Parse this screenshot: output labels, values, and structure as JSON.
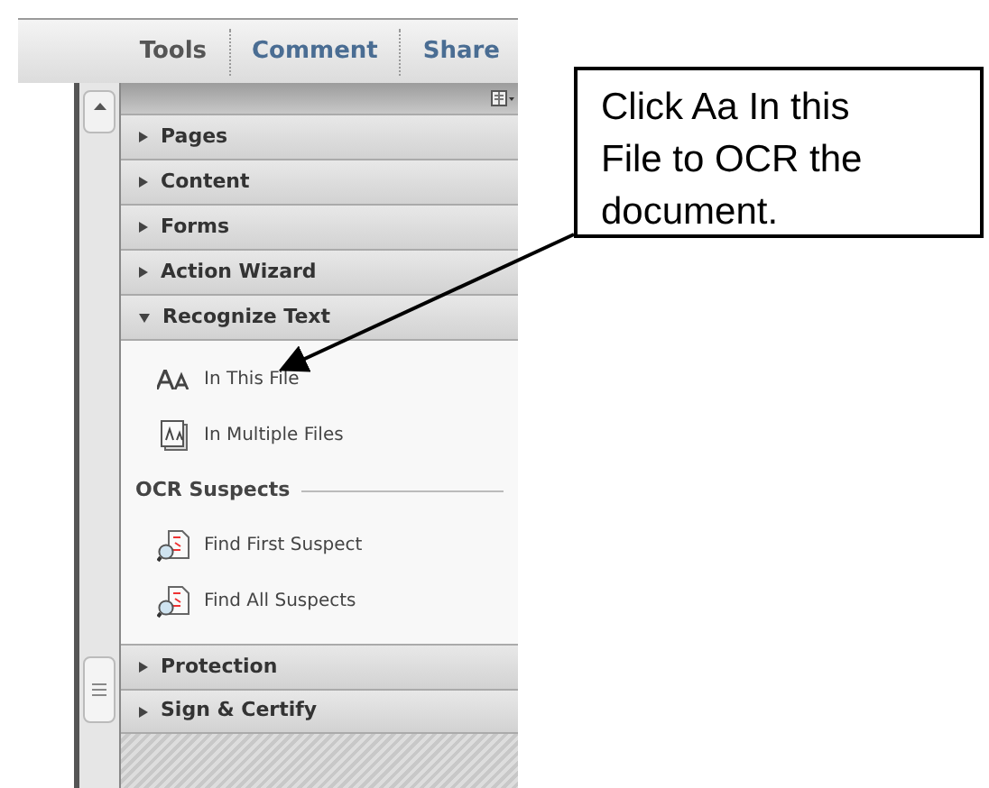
{
  "tabs": [
    {
      "label": "Tools"
    },
    {
      "label": "Comment"
    },
    {
      "label": "Share"
    }
  ],
  "panels": [
    {
      "label": "Pages",
      "expanded": false
    },
    {
      "label": "Content",
      "expanded": false
    },
    {
      "label": "Forms",
      "expanded": false
    },
    {
      "label": "Action Wizard",
      "expanded": false
    },
    {
      "label": "Recognize Text",
      "expanded": true,
      "items": [
        {
          "kind": "text-tool",
          "label": "In This File"
        },
        {
          "kind": "batch-tool",
          "label": "In Multiple Files"
        },
        {
          "kind": "heading",
          "label": "OCR Suspects"
        },
        {
          "kind": "suspect-tool",
          "label": "Find First Suspect"
        },
        {
          "kind": "suspect-tool",
          "label": "Find All Suspects"
        }
      ]
    },
    {
      "label": "Protection",
      "expanded": false
    },
    {
      "label": "Sign & Certify",
      "expanded": false
    }
  ],
  "callout": {
    "text": "Click Aa In this File to OCR the document."
  }
}
